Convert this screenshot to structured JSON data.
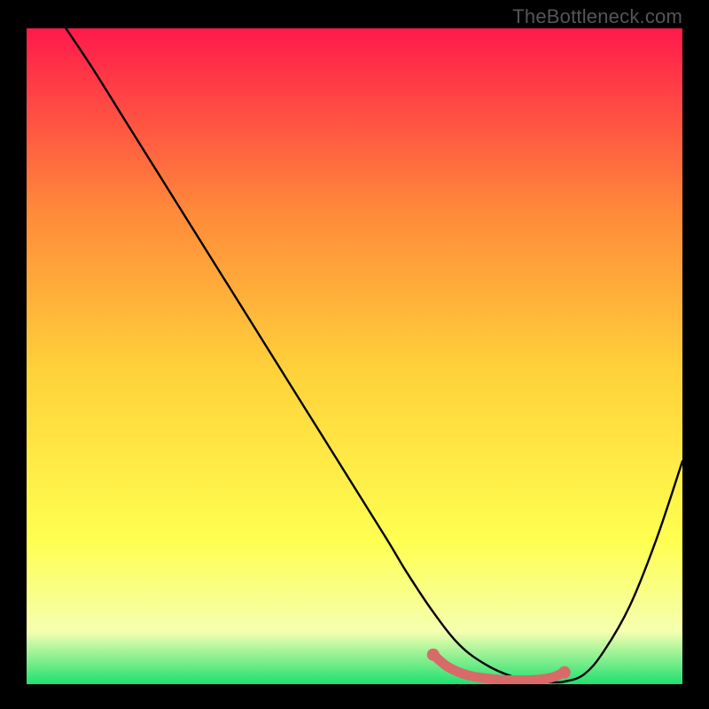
{
  "watermark": "TheBottleneck.com",
  "gradient": {
    "top": "#ff1a4b",
    "mid_upper": "#ff8a3a",
    "mid": "#ffd13a",
    "mid_lower": "#ffff50",
    "lower": "#f5ffb0",
    "bottom": "#20e070"
  },
  "chart_data": {
    "type": "line",
    "title": "",
    "xlabel": "",
    "ylabel": "",
    "xlim": [
      0,
      100
    ],
    "ylim": [
      0,
      100
    ],
    "grid": false,
    "series": [
      {
        "name": "bottleneck-curve",
        "color": "#000000",
        "x": [
          6,
          10,
          15,
          20,
          25,
          30,
          35,
          40,
          45,
          50,
          55,
          58,
          62,
          66,
          70,
          74,
          78,
          80,
          82,
          85,
          88,
          92,
          96,
          100
        ],
        "values": [
          100,
          94,
          86,
          78,
          70,
          62,
          54,
          46,
          38,
          30,
          22,
          17,
          11,
          6,
          3,
          1.2,
          0.4,
          0.3,
          0.4,
          1.5,
          5,
          12,
          22,
          34
        ]
      },
      {
        "name": "minimum-marker",
        "color": "#d86a6a",
        "x": [
          62,
          64,
          66,
          68,
          70,
          72,
          74,
          76,
          78,
          80,
          82
        ],
        "values": [
          4.5,
          2.8,
          1.8,
          1.2,
          0.9,
          0.7,
          0.6,
          0.6,
          0.7,
          1.0,
          1.8
        ]
      }
    ],
    "annotations": []
  }
}
